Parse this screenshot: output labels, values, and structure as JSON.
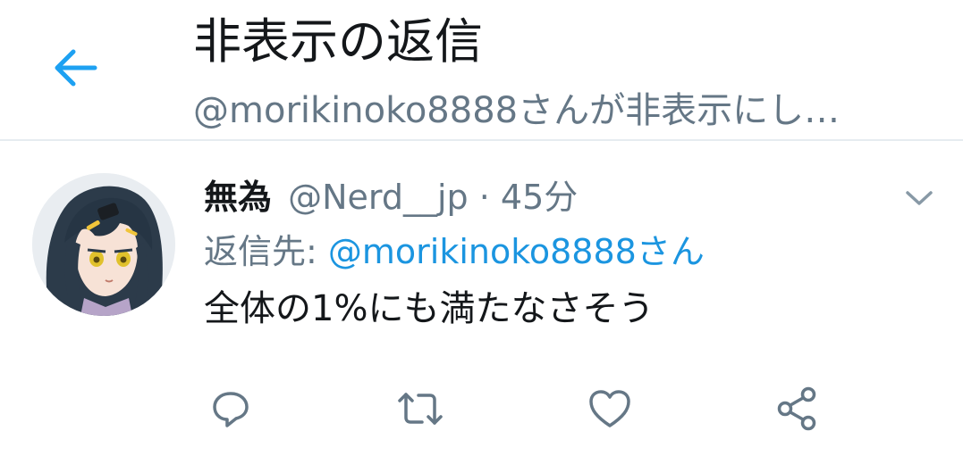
{
  "header": {
    "title": "非表示の返信",
    "subtitle": "@morikinoko8888さんが非表示にし…",
    "back_icon": "back-arrow-icon",
    "accent_color": "#1da1f2"
  },
  "tweet": {
    "display_name": "無為",
    "handle": "@Nerd__jp",
    "separator": " · ",
    "time": "45分",
    "reply_prefix": "返信先: ",
    "reply_mention": "@morikinoko8888さん",
    "text": "全体の1%にも満たなさそう",
    "menu_icon": "chevron-down-icon",
    "avatar_icon": "avatar",
    "actions": [
      {
        "icon": "reply-icon"
      },
      {
        "icon": "retweet-icon"
      },
      {
        "icon": "heart-icon"
      },
      {
        "icon": "share-icon"
      }
    ],
    "colors": {
      "text": "#14171a",
      "secondary": "#657786",
      "link": "#1b95e0"
    }
  }
}
